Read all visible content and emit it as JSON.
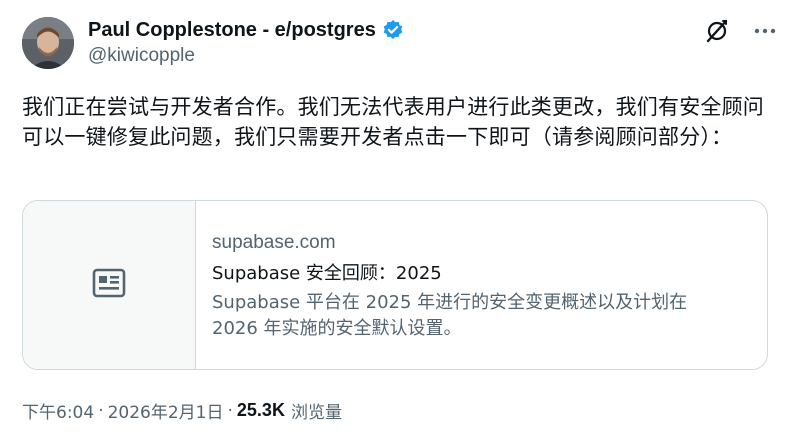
{
  "author": {
    "display_name": "Paul Copplestone - e/postgres",
    "handle": "@kiwicopple",
    "verified": true,
    "verified_color": "#1d9bf0",
    "avatar_icon": "profile-photo"
  },
  "actions": {
    "grok_icon": "grok-slash-icon",
    "more_icon": "more-dots-icon"
  },
  "tweet": {
    "text": "我们正在尝试与开发者合作。我们无法代表用户进行此类更改，我们有安全顾问可以一键修复此问题，我们只需要开发者点击一下即可（请参阅顾问部分）："
  },
  "card": {
    "thumb_icon": "article-icon",
    "domain": "supabase.com",
    "title": "Supabase 安全回顾：2025",
    "description": "Supabase 平台在 2025 年进行的安全变更概述以及计划在 2026 年实施的安全默认设置。"
  },
  "meta": {
    "time": "下午6:04",
    "separator": "·",
    "date": "2026年2月1日",
    "views_count": "25.3K",
    "views_label": "浏览量"
  }
}
